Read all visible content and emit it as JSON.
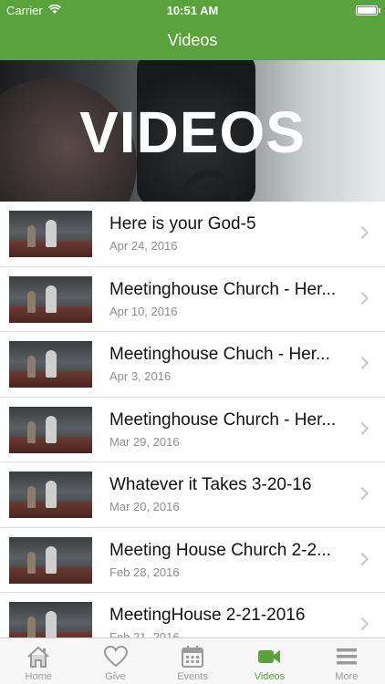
{
  "status": {
    "carrier": "Carrier",
    "time": "10:51 AM"
  },
  "nav": {
    "title": "Videos"
  },
  "hero": {
    "title": "VIDEOS"
  },
  "videos": [
    {
      "title": "Here is your God-5",
      "date": "Apr 24, 2016"
    },
    {
      "title": "Meetinghouse Church - Her...",
      "date": "Apr 10, 2016"
    },
    {
      "title": "Meetinghouse Chuch - Her...",
      "date": "Apr 3, 2016"
    },
    {
      "title": "Meetinghouse Church - Her...",
      "date": "Mar 29, 2016"
    },
    {
      "title": "Whatever it Takes 3-20-16",
      "date": "Mar 20, 2016"
    },
    {
      "title": "Meeting House Church 2-2...",
      "date": "Feb 28, 2016"
    },
    {
      "title": "MeetingHouse 2-21-2016",
      "date": "Feb 21, 2016"
    }
  ],
  "tabs": [
    {
      "label": "Home",
      "icon": "home-icon",
      "active": false
    },
    {
      "label": "Give",
      "icon": "heart-icon",
      "active": false
    },
    {
      "label": "Events",
      "icon": "calendar-icon",
      "active": false
    },
    {
      "label": "Videos",
      "icon": "video-camera-icon",
      "active": true
    },
    {
      "label": "More",
      "icon": "menu-icon",
      "active": false
    }
  ],
  "colors": {
    "brand": "#5aa33c",
    "inactive_tab": "#9b9b9b"
  }
}
